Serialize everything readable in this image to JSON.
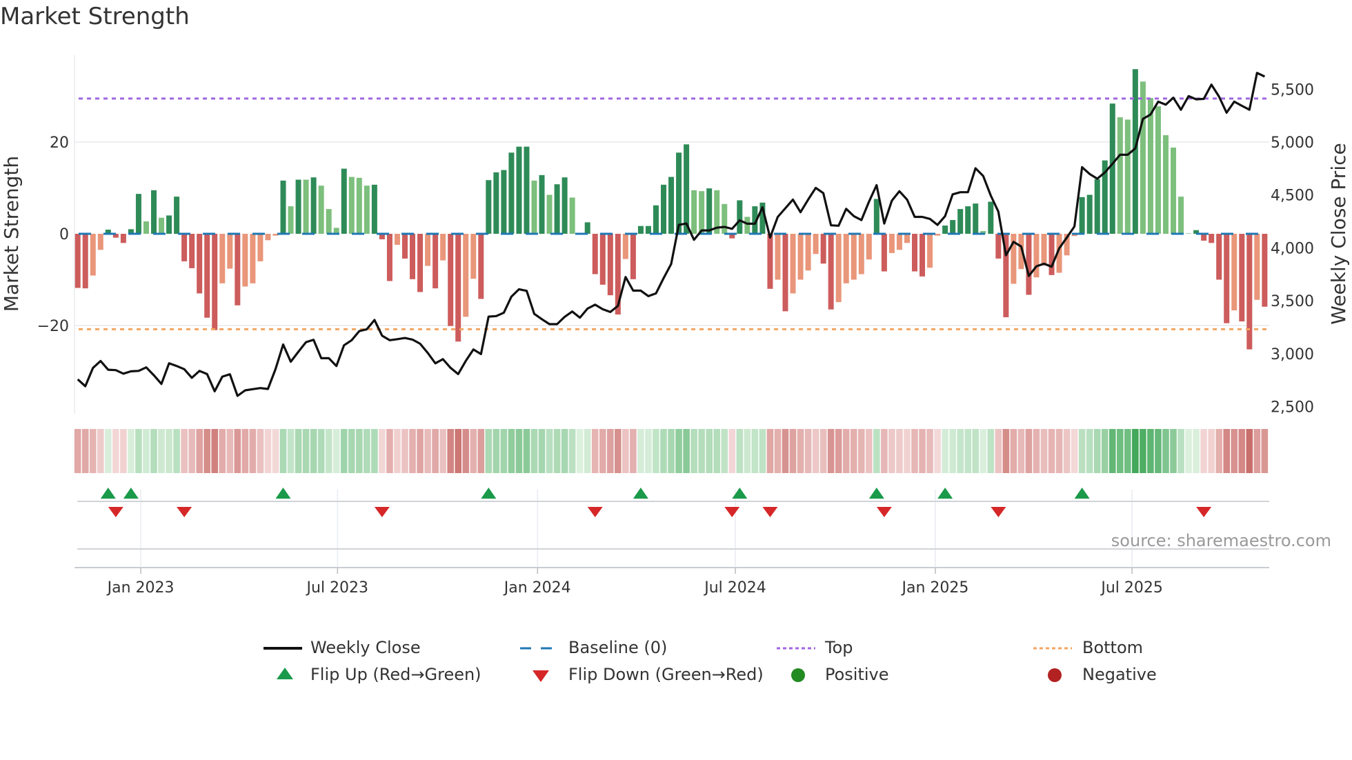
{
  "title": "Market Strength",
  "source": "source: sharemaestro.com",
  "colors": {
    "strong_green": "#2e8b57",
    "weak_green": "#7dbf7d",
    "strong_red": "#cd5c5c",
    "weak_red": "#e9967a",
    "baseline": "#1f77b4",
    "top": "#a066e0",
    "bottom": "#f4a460",
    "flip_up": "#1a9a4a",
    "flip_down": "#d62728",
    "positive": "#228b22",
    "negative": "#b22222",
    "price": "#111111"
  },
  "legend": {
    "weekly_close": "Weekly Close",
    "baseline": "Baseline (0)",
    "top": "Top",
    "bottom": "Bottom",
    "flip_up": "Flip Up (Red→Green)",
    "flip_down": "Flip Down (Green→Red)",
    "positive": "Positive",
    "negative": "Negative"
  },
  "chart_data": {
    "type": "bar",
    "title": "Market Strength",
    "ylabel": "Market Strength",
    "y2label": "Weekly Close Price",
    "start_date": "2022-11-04",
    "interval": "weekly",
    "ylim": [
      -39.5,
      39
    ],
    "y2lim": [
      2450,
      5850
    ],
    "yticks": [
      {
        "v": 20,
        "label": "20"
      },
      {
        "v": 0,
        "label": "0"
      },
      {
        "v": -20,
        "label": "−20"
      }
    ],
    "y2ticks": [
      {
        "v": 5500,
        "label": "5,500"
      },
      {
        "v": 5000,
        "label": "5,000"
      },
      {
        "v": 4500,
        "label": "4,500"
      },
      {
        "v": 4000,
        "label": "4,000"
      },
      {
        "v": 3500,
        "label": "3,500"
      },
      {
        "v": 3000,
        "label": "3,000"
      },
      {
        "v": 2500,
        "label": "2,500"
      }
    ],
    "xticks": [
      {
        "date": "2023-01-01",
        "label": "Jan 2023"
      },
      {
        "date": "2023-07-01",
        "label": "Jul 2023"
      },
      {
        "date": "2024-01-01",
        "label": "Jan 2024"
      },
      {
        "date": "2024-07-01",
        "label": "Jul 2024"
      },
      {
        "date": "2025-01-01",
        "label": "Jan 2025"
      },
      {
        "date": "2025-07-01",
        "label": "Jul 2025"
      }
    ],
    "top_level": 29.5,
    "bottom_level": -20.8,
    "baseline": 0,
    "strength": [
      -11.8,
      -11.9,
      -9.1,
      -3.5,
      0.9,
      -0.85,
      -2,
      1,
      8.7,
      2.7,
      9.5,
      3.5,
      4,
      8.1,
      -6,
      -7.5,
      -13,
      -18.3,
      -21,
      -10.8,
      -7.6,
      -15.6,
      -11.5,
      -10.8,
      -6,
      -1.4,
      -0.4,
      11.6,
      6,
      11.8,
      11.8,
      12.3,
      10.5,
      5.4,
      1.3,
      14.2,
      12.4,
      12.2,
      10.5,
      10.7,
      -1.2,
      -10.3,
      -2.4,
      -5.4,
      -9.9,
      -12.7,
      -7,
      -11.9,
      -5.8,
      -20.1,
      -23.5,
      -18.1,
      -9.8,
      -14.2,
      11.7,
      13.4,
      13.9,
      17.7,
      19,
      19,
      11.6,
      12.8,
      8.5,
      10.8,
      12.3,
      7.9,
      0.1,
      2.5,
      -8.8,
      -11.1,
      -13.4,
      -17.6,
      -5.5,
      -9.9,
      1.7,
      1.7,
      6.2,
      10.7,
      12.4,
      17.7,
      19.5,
      9.5,
      9.3,
      9.9,
      9.5,
      6.5,
      -1,
      7.3,
      3.7,
      6,
      6.8,
      -12,
      -10,
      -16.9,
      -13,
      -10,
      -8,
      -4.4,
      -6.5,
      -16.5,
      -14.9,
      -10.8,
      -10,
      -8.8,
      -5.6,
      7.6,
      -8.2,
      -4.2,
      -3.5,
      -2,
      -8.2,
      -9.3,
      -7.4,
      -0.4,
      1.8,
      3,
      5.4,
      6,
      6.6,
      0.6,
      7,
      -5.4,
      -18.2,
      -10.9,
      -7.7,
      -13.3,
      -9.5,
      -6.9,
      -9,
      -8.5,
      -4.7,
      -0.5,
      8,
      8.5,
      11.9,
      16,
      28.4,
      25.4,
      24.9,
      35.9,
      33.2,
      29.6,
      27.8,
      21.5,
      18.8,
      8.1,
      0.1,
      0.8,
      -1.5,
      -2,
      -10,
      -19.5,
      -16.7,
      -19.1,
      -25.2,
      -14.4,
      -15.9
    ],
    "shade": "RRrrGRRGGgGgGGRRRRRrrRrrrrrGgGgGgggGgggGRRrRRRrRrRRrrRGGGGGGgGgGGggGRRRRrRGGGGGGGggGggRGgGGRrRrrrrRRrrrrrGRrrrRRrrGGGGGgGRRrrRrrRrrrGGGGGggGgggggggGRRRRrRRrR",
    "weekly_close": [
      2757,
      2692,
      2866,
      2931,
      2848,
      2844,
      2811,
      2833,
      2837,
      2870,
      2796,
      2714,
      2909,
      2883,
      2853,
      2772,
      2837,
      2807,
      2644,
      2783,
      2805,
      2601,
      2653,
      2664,
      2675,
      2666,
      2855,
      3087,
      2924,
      3018,
      3109,
      3131,
      2957,
      2957,
      2883,
      3079,
      3127,
      3213,
      3231,
      3318,
      3170,
      3127,
      3137,
      3148,
      3133,
      3094,
      3007,
      2909,
      2948,
      2866,
      2807,
      2931,
      3040,
      2996,
      3350,
      3355,
      3387,
      3539,
      3609,
      3594,
      3376,
      3326,
      3279,
      3279,
      3348,
      3398,
      3340,
      3426,
      3463,
      3420,
      3394,
      3452,
      3724,
      3596,
      3596,
      3544,
      3570,
      3713,
      3848,
      4217,
      4230,
      4076,
      4165,
      4165,
      4191,
      4198,
      4180,
      4261,
      4228,
      4228,
      4383,
      4098,
      4293,
      4374,
      4456,
      4337,
      4456,
      4567,
      4517,
      4213,
      4209,
      4369,
      4300,
      4263,
      4437,
      4593,
      4230,
      4446,
      4535,
      4456,
      4293,
      4293,
      4274,
      4217,
      4300,
      4506,
      4526,
      4526,
      4752,
      4680,
      4495,
      4343,
      3930,
      4057,
      4013,
      3735,
      3826,
      3850,
      3822,
      3996,
      4098,
      4202,
      4763,
      4698,
      4654,
      4713,
      4795,
      4880,
      4880,
      4941,
      5219,
      5260,
      5382,
      5354,
      5419,
      5306,
      5434,
      5404,
      5408,
      5543,
      5430,
      5278,
      5382,
      5343,
      5306,
      5654,
      5619
    ],
    "flip_up_weeks": [
      5,
      8,
      28,
      55,
      75,
      88,
      106,
      115,
      133
    ],
    "flip_down_weeks": [
      6,
      15,
      41,
      69,
      87,
      92,
      107,
      122,
      149
    ],
    "legend_position": "bottom"
  }
}
